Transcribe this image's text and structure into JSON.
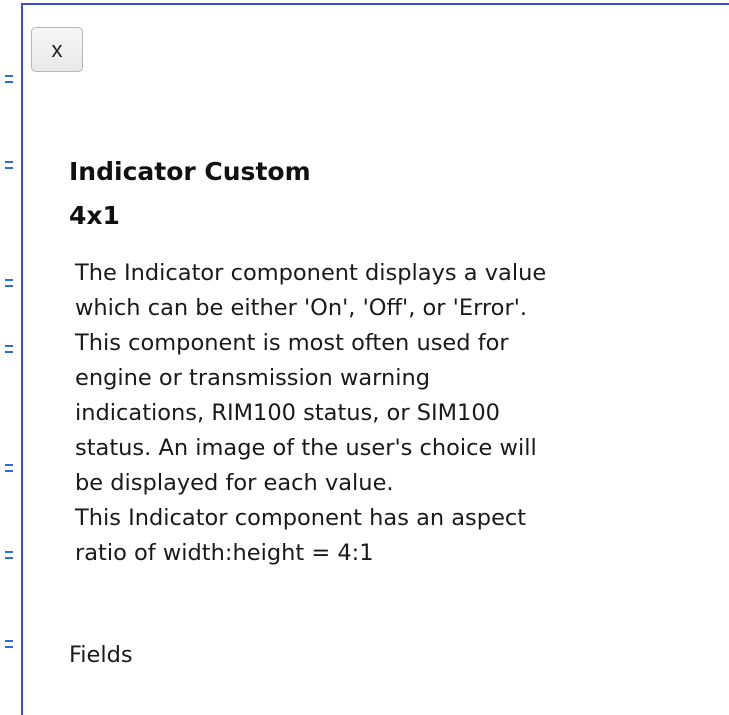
{
  "dialog": {
    "close_label": "x",
    "title_line1": "Indicator Custom",
    "title_line2": "4x1",
    "description_lines": [
      "The Indicator component displays a value",
      "which can be either 'On', 'Off', or 'Error'.",
      "This component is most often used for",
      "engine or transmission warning",
      "indications, RIM100 status, or SIM100",
      "status. An image of the user's choice will",
      "be displayed for each value.",
      "This Indicator component has an aspect",
      "ratio of width:height = 4:1"
    ],
    "fields_label": "Fields"
  },
  "colors": {
    "panel_border": "#3c4dd8",
    "background_mark": "#2b6fd6"
  },
  "icons": {
    "close": "close-icon"
  }
}
